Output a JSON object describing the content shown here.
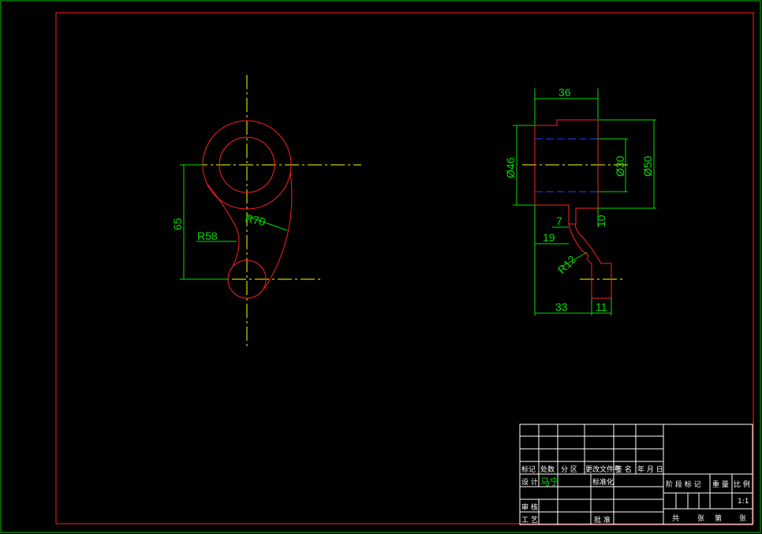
{
  "colors": {
    "background": "#000000",
    "border": "#00c000",
    "part": "#ff2020",
    "centerline": "#ffff00",
    "dimension": "#00e000",
    "hidden": "#2040ff",
    "titleblock": "#ffffff"
  },
  "left_view": {
    "dims": {
      "height": "65",
      "r_outer": "R58",
      "r_arm": "R70"
    }
  },
  "right_view": {
    "dims": {
      "width_top": "36",
      "dia_46": "Ø46",
      "dia_30": "Ø30",
      "dia_50": "Ø50",
      "d7": "7",
      "d10": "10",
      "d19": "19",
      "r12": "R12",
      "d33": "33",
      "d11": "11"
    }
  },
  "title_block": {
    "headers": [
      "标记",
      "处数",
      "分 区",
      "更改文件号",
      "签 名",
      "年 月 日"
    ],
    "design_label": "设 计",
    "designer": "马宁",
    "standard_label": "标准化",
    "review_label": "审 核",
    "process_label": "工 艺",
    "approve_label": "批 准",
    "stage_label": "阶 段 标 记",
    "weight_label": "重 量",
    "scale_label": "比 例",
    "scale_value": "1:1",
    "total_label": "共",
    "sheets_label": "张",
    "page_label": "第",
    "page_sheets_label": "张"
  }
}
